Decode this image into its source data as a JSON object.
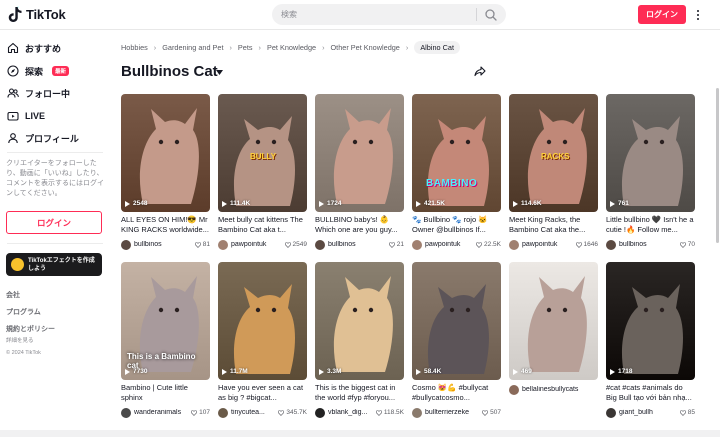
{
  "app": {
    "logo_text": "TikTok"
  },
  "header": {
    "search_placeholder": "検索",
    "login_label": "ログイン"
  },
  "sidebar": {
    "nav": [
      {
        "label": "おすすめ",
        "icon": "home-icon"
      },
      {
        "label": "探索",
        "icon": "compass-icon",
        "badge": "最新"
      },
      {
        "label": "フォロー中",
        "icon": "people-icon"
      },
      {
        "label": "LIVE",
        "icon": "live-icon"
      },
      {
        "label": "プロフィール",
        "icon": "profile-icon"
      }
    ],
    "login_prompt": "クリエイターをフォローしたり、動画に「いいね」したり、コメントを表示するにはログインしてください。",
    "login_label": "ログイン",
    "effect_label": "TikTokエフェクトを作成しよう",
    "links": [
      "会社",
      "プログラム",
      "規約とポリシー"
    ],
    "sub_link": "詳細を見る",
    "copyright": "© 2024 TikTok"
  },
  "breadcrumb": [
    "Hobbies",
    "Gardening and Pet",
    "Pets",
    "Pet Knowledge",
    "Other Pet Knowledge",
    "Albino Cat"
  ],
  "page_title": "Bullbinos Cat",
  "videos": [
    {
      "views": "2548",
      "desc": "ALL EYES ON HIM!😎 Mr KING RACKS worldwide...",
      "user": "bullbinos",
      "likes": "81",
      "bg": "#7a5a48",
      "cat": "#c49a8a",
      "avatar": "#5b4a42"
    },
    {
      "views": "111.4K",
      "desc": "Meet bully cat kittens The Bambino Cat aka t...",
      "user": "pawpointuk",
      "likes": "2549",
      "bg": "#6a5a50",
      "cat": "#b59384",
      "avatar": "#a08070",
      "overlay": "BULLY"
    },
    {
      "views": "1724",
      "desc": "BULLBINO baby's! 👶 Which one are you guy...",
      "user": "bullbinos",
      "likes": "21",
      "bg": "#9c9086",
      "cat": "#c89c8c",
      "avatar": "#5b4a42"
    },
    {
      "views": "421.5K",
      "desc": "🐾 Bullbino 🐾 rojo 🐱 Owner @bullbinos If...",
      "user": "pawpointuk",
      "likes": "22.5K",
      "bg": "#7e6450",
      "cat": "#c48878",
      "avatar": "#a08070",
      "overlay": "BAMBINO"
    },
    {
      "views": "114.6K",
      "desc": "Meet King Racks, the Bambino Cat aka the...",
      "user": "pawpointuk",
      "likes": "1646",
      "bg": "#6a5444",
      "cat": "#c08878",
      "avatar": "#a08070",
      "overlay": "RACKS"
    },
    {
      "views": "761",
      "desc": "Little bullbino 🖤 Isn't he a cutie !🔥 Follow me...",
      "user": "bullbinos",
      "likes": "70",
      "bg": "#6c6864",
      "cat": "#9a8a84",
      "avatar": "#5b4a42"
    },
    {
      "views": "7730",
      "desc": "Bambino | Cute little sphinx",
      "user": "wanderanimals",
      "likes": "107",
      "bg": "#c4b2a4",
      "cat": "#a89a9c",
      "avatar": "#4a4a4a",
      "overlay": "This is a Bambino cat"
    },
    {
      "views": "11.7M",
      "desc": "Have you ever seen a cat as big ? #bigcat...",
      "user": "tinycutea...",
      "likes": "345.7K",
      "bg": "#7a6a54",
      "cat": "#d09a58",
      "avatar": "#6a5a48"
    },
    {
      "views": "3.3M",
      "desc": "This is the biggest cat in the world #fyp #foryou...",
      "user": "vblank_dig...",
      "likes": "118.5K",
      "bg": "#8a8070",
      "cat": "#e0c094",
      "avatar": "#222222"
    },
    {
      "views": "58.4K",
      "desc": "Cosmo 😻💪 #bullycat #bullycatcosmo...",
      "user": "bullterrierzeke",
      "likes": "507",
      "bg": "#8a7a6c",
      "cat": "#5c5458",
      "avatar": "#8a7a6c"
    },
    {
      "views": "469",
      "desc": "",
      "user": "bellalinesbullycats",
      "likes": "",
      "bg": "#ece8e4",
      "cat": "#b8a098",
      "avatar": "#8a6a5a"
    },
    {
      "views": "1718",
      "desc": "#cat #cats #animals do Big Bull tạo với bản nhạ...",
      "user": "giant_bullh",
      "likes": "85",
      "bg": "#2a2624",
      "cat": "#6a625c",
      "avatar": "#3a3634"
    }
  ],
  "colors": {
    "accent": "#fe2c55",
    "text": "#161823",
    "muted": "#8a8b91"
  }
}
